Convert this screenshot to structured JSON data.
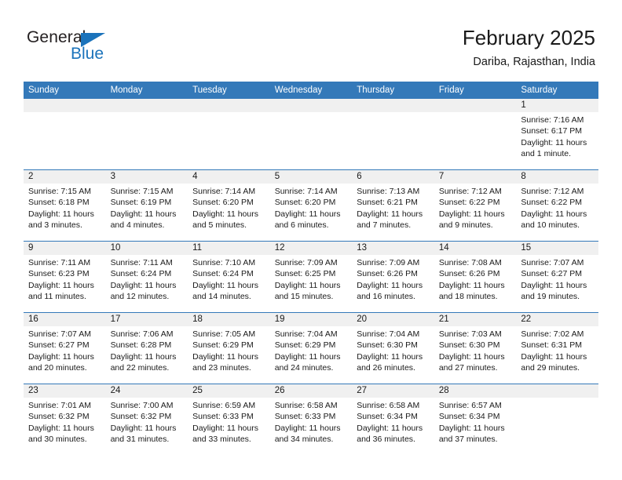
{
  "brand": {
    "name_part1": "General",
    "name_part2": "Blue",
    "triangle_icon": "triangle-logo-icon",
    "accent_color": "#1b73bb"
  },
  "header": {
    "title": "February 2025",
    "subtitle": "Dariba, Rajasthan, India"
  },
  "colors": {
    "header_row_bg": "#3479b9",
    "day_band_bg": "#f0f0f0",
    "row_divider": "#3479b9",
    "text": "#1a1a1a"
  },
  "weekdays": [
    "Sunday",
    "Monday",
    "Tuesday",
    "Wednesday",
    "Thursday",
    "Friday",
    "Saturday"
  ],
  "labels": {
    "sunrise_prefix": "Sunrise:",
    "sunset_prefix": "Sunset:",
    "daylight_prefix": "Daylight:"
  },
  "weeks": [
    [
      {
        "day": "",
        "sunrise": "",
        "sunset": "",
        "daylight": "",
        "empty": true
      },
      {
        "day": "",
        "sunrise": "",
        "sunset": "",
        "daylight": "",
        "empty": true
      },
      {
        "day": "",
        "sunrise": "",
        "sunset": "",
        "daylight": "",
        "empty": true
      },
      {
        "day": "",
        "sunrise": "",
        "sunset": "",
        "daylight": "",
        "empty": true
      },
      {
        "day": "",
        "sunrise": "",
        "sunset": "",
        "daylight": "",
        "empty": true
      },
      {
        "day": "",
        "sunrise": "",
        "sunset": "",
        "daylight": "",
        "empty": true
      },
      {
        "day": "1",
        "sunrise": "Sunrise: 7:16 AM",
        "sunset": "Sunset: 6:17 PM",
        "daylight": "Daylight: 11 hours and 1 minute."
      }
    ],
    [
      {
        "day": "2",
        "sunrise": "Sunrise: 7:15 AM",
        "sunset": "Sunset: 6:18 PM",
        "daylight": "Daylight: 11 hours and 3 minutes."
      },
      {
        "day": "3",
        "sunrise": "Sunrise: 7:15 AM",
        "sunset": "Sunset: 6:19 PM",
        "daylight": "Daylight: 11 hours and 4 minutes."
      },
      {
        "day": "4",
        "sunrise": "Sunrise: 7:14 AM",
        "sunset": "Sunset: 6:20 PM",
        "daylight": "Daylight: 11 hours and 5 minutes."
      },
      {
        "day": "5",
        "sunrise": "Sunrise: 7:14 AM",
        "sunset": "Sunset: 6:20 PM",
        "daylight": "Daylight: 11 hours and 6 minutes."
      },
      {
        "day": "6",
        "sunrise": "Sunrise: 7:13 AM",
        "sunset": "Sunset: 6:21 PM",
        "daylight": "Daylight: 11 hours and 7 minutes."
      },
      {
        "day": "7",
        "sunrise": "Sunrise: 7:12 AM",
        "sunset": "Sunset: 6:22 PM",
        "daylight": "Daylight: 11 hours and 9 minutes."
      },
      {
        "day": "8",
        "sunrise": "Sunrise: 7:12 AM",
        "sunset": "Sunset: 6:22 PM",
        "daylight": "Daylight: 11 hours and 10 minutes."
      }
    ],
    [
      {
        "day": "9",
        "sunrise": "Sunrise: 7:11 AM",
        "sunset": "Sunset: 6:23 PM",
        "daylight": "Daylight: 11 hours and 11 minutes."
      },
      {
        "day": "10",
        "sunrise": "Sunrise: 7:11 AM",
        "sunset": "Sunset: 6:24 PM",
        "daylight": "Daylight: 11 hours and 12 minutes."
      },
      {
        "day": "11",
        "sunrise": "Sunrise: 7:10 AM",
        "sunset": "Sunset: 6:24 PM",
        "daylight": "Daylight: 11 hours and 14 minutes."
      },
      {
        "day": "12",
        "sunrise": "Sunrise: 7:09 AM",
        "sunset": "Sunset: 6:25 PM",
        "daylight": "Daylight: 11 hours and 15 minutes."
      },
      {
        "day": "13",
        "sunrise": "Sunrise: 7:09 AM",
        "sunset": "Sunset: 6:26 PM",
        "daylight": "Daylight: 11 hours and 16 minutes."
      },
      {
        "day": "14",
        "sunrise": "Sunrise: 7:08 AM",
        "sunset": "Sunset: 6:26 PM",
        "daylight": "Daylight: 11 hours and 18 minutes."
      },
      {
        "day": "15",
        "sunrise": "Sunrise: 7:07 AM",
        "sunset": "Sunset: 6:27 PM",
        "daylight": "Daylight: 11 hours and 19 minutes."
      }
    ],
    [
      {
        "day": "16",
        "sunrise": "Sunrise: 7:07 AM",
        "sunset": "Sunset: 6:27 PM",
        "daylight": "Daylight: 11 hours and 20 minutes."
      },
      {
        "day": "17",
        "sunrise": "Sunrise: 7:06 AM",
        "sunset": "Sunset: 6:28 PM",
        "daylight": "Daylight: 11 hours and 22 minutes."
      },
      {
        "day": "18",
        "sunrise": "Sunrise: 7:05 AM",
        "sunset": "Sunset: 6:29 PM",
        "daylight": "Daylight: 11 hours and 23 minutes."
      },
      {
        "day": "19",
        "sunrise": "Sunrise: 7:04 AM",
        "sunset": "Sunset: 6:29 PM",
        "daylight": "Daylight: 11 hours and 24 minutes."
      },
      {
        "day": "20",
        "sunrise": "Sunrise: 7:04 AM",
        "sunset": "Sunset: 6:30 PM",
        "daylight": "Daylight: 11 hours and 26 minutes."
      },
      {
        "day": "21",
        "sunrise": "Sunrise: 7:03 AM",
        "sunset": "Sunset: 6:30 PM",
        "daylight": "Daylight: 11 hours and 27 minutes."
      },
      {
        "day": "22",
        "sunrise": "Sunrise: 7:02 AM",
        "sunset": "Sunset: 6:31 PM",
        "daylight": "Daylight: 11 hours and 29 minutes."
      }
    ],
    [
      {
        "day": "23",
        "sunrise": "Sunrise: 7:01 AM",
        "sunset": "Sunset: 6:32 PM",
        "daylight": "Daylight: 11 hours and 30 minutes."
      },
      {
        "day": "24",
        "sunrise": "Sunrise: 7:00 AM",
        "sunset": "Sunset: 6:32 PM",
        "daylight": "Daylight: 11 hours and 31 minutes."
      },
      {
        "day": "25",
        "sunrise": "Sunrise: 6:59 AM",
        "sunset": "Sunset: 6:33 PM",
        "daylight": "Daylight: 11 hours and 33 minutes."
      },
      {
        "day": "26",
        "sunrise": "Sunrise: 6:58 AM",
        "sunset": "Sunset: 6:33 PM",
        "daylight": "Daylight: 11 hours and 34 minutes."
      },
      {
        "day": "27",
        "sunrise": "Sunrise: 6:58 AM",
        "sunset": "Sunset: 6:34 PM",
        "daylight": "Daylight: 11 hours and 36 minutes."
      },
      {
        "day": "28",
        "sunrise": "Sunrise: 6:57 AM",
        "sunset": "Sunset: 6:34 PM",
        "daylight": "Daylight: 11 hours and 37 minutes."
      },
      {
        "day": "",
        "sunrise": "",
        "sunset": "",
        "daylight": "",
        "empty": true
      }
    ]
  ]
}
